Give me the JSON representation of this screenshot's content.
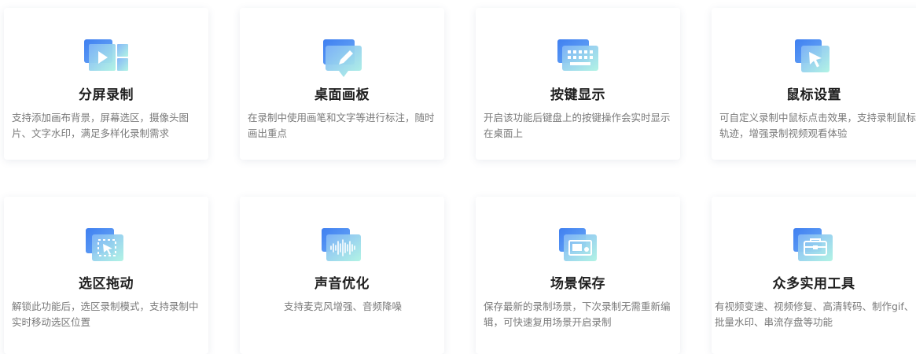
{
  "features": [
    {
      "title": "分屏录制",
      "desc": "支持添加画布背景，屏幕选区，摄像头图片、文字水印，满足多样化录制需求",
      "icon": "split-screen-icon"
    },
    {
      "title": "桌面画板",
      "desc": "在录制中使用画笔和文字等进行标注，随时画出重点",
      "icon": "pen-board-icon"
    },
    {
      "title": "按键显示",
      "desc": "开启该功能后键盘上的按键操作会实时显示在桌面上",
      "icon": "keyboard-icon"
    },
    {
      "title": "鼠标设置",
      "desc": "可自定义录制中鼠标点击效果，支持录制鼠标轨迹，增强录制视频观看体验",
      "icon": "cursor-icon"
    },
    {
      "title": "选区拖动",
      "desc": "解锁此功能后，选区录制模式，支持录制中实时移动选区位置",
      "icon": "select-drag-icon"
    },
    {
      "title": "声音优化",
      "desc": "支持麦克风增强、音频降噪",
      "icon": "audio-wave-icon"
    },
    {
      "title": "场景保存",
      "desc": "保存最新的录制场景，下次录制无需重新编辑，可快速复用场景开启录制",
      "icon": "scene-save-icon"
    },
    {
      "title": "众多实用工具",
      "desc": "有视频变速、视频修复、高清转码、制作gif、批量水印、串流存盘等功能",
      "icon": "toolbox-icon"
    }
  ],
  "colors": {
    "accent_blue": "#4f8df5",
    "accent_mint": "#a8f0e0",
    "title": "#1f1f1f",
    "desc": "#7a7a7a"
  }
}
